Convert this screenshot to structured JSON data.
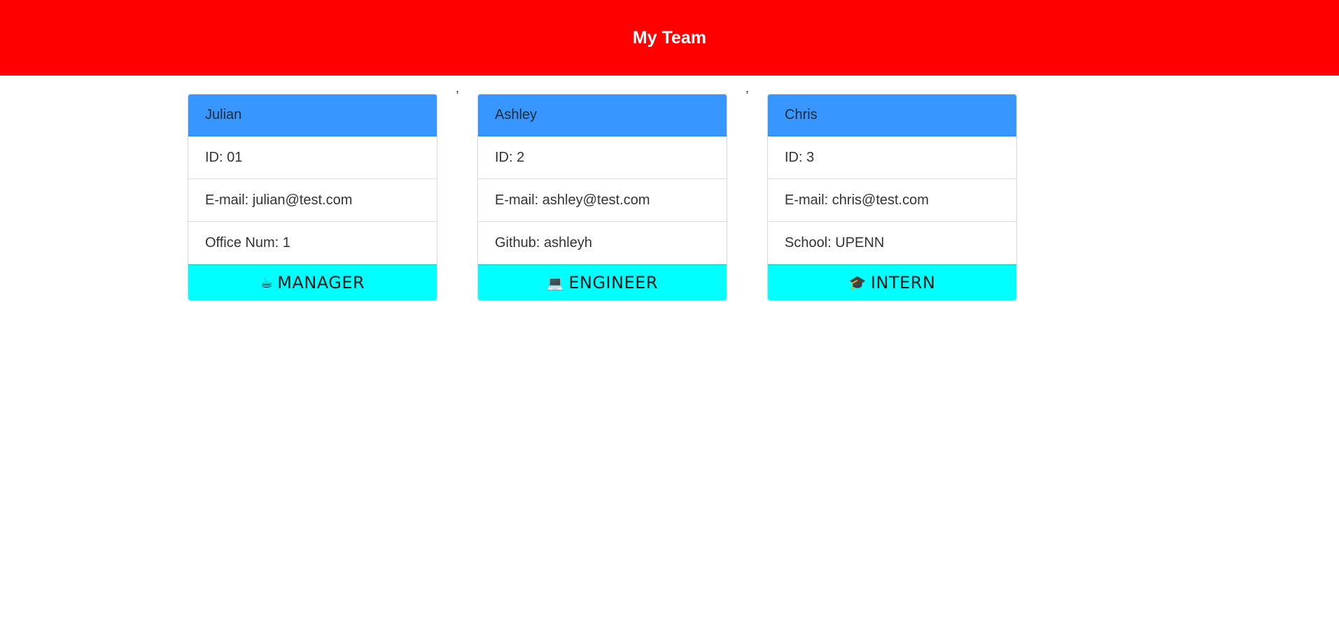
{
  "header": {
    "title": "My Team"
  },
  "separators": [
    ",",
    ","
  ],
  "cards": [
    {
      "name": "Julian",
      "id": "ID: 01",
      "email": "E-mail: julian@test.com",
      "extra": "Office Num: 1",
      "role": "MANAGER",
      "role_icon": "coffee-icon",
      "role_glyph": "☕"
    },
    {
      "name": "Ashley",
      "id": "ID: 2",
      "email": "E-mail: ashley@test.com",
      "extra": "Github: ashleyh",
      "role": "ENGINEER",
      "role_icon": "laptop-icon",
      "role_glyph": "💻"
    },
    {
      "name": "Chris",
      "id": "ID: 3",
      "email": "E-mail: chris@test.com",
      "extra": "School: UPENN",
      "role": "INTERN",
      "role_icon": "graduation-cap-icon",
      "role_glyph": "🎓"
    }
  ],
  "colors": {
    "header_bg": "#ff0000",
    "card_header_bg": "#3796ff",
    "role_bg": "#00ffff"
  }
}
